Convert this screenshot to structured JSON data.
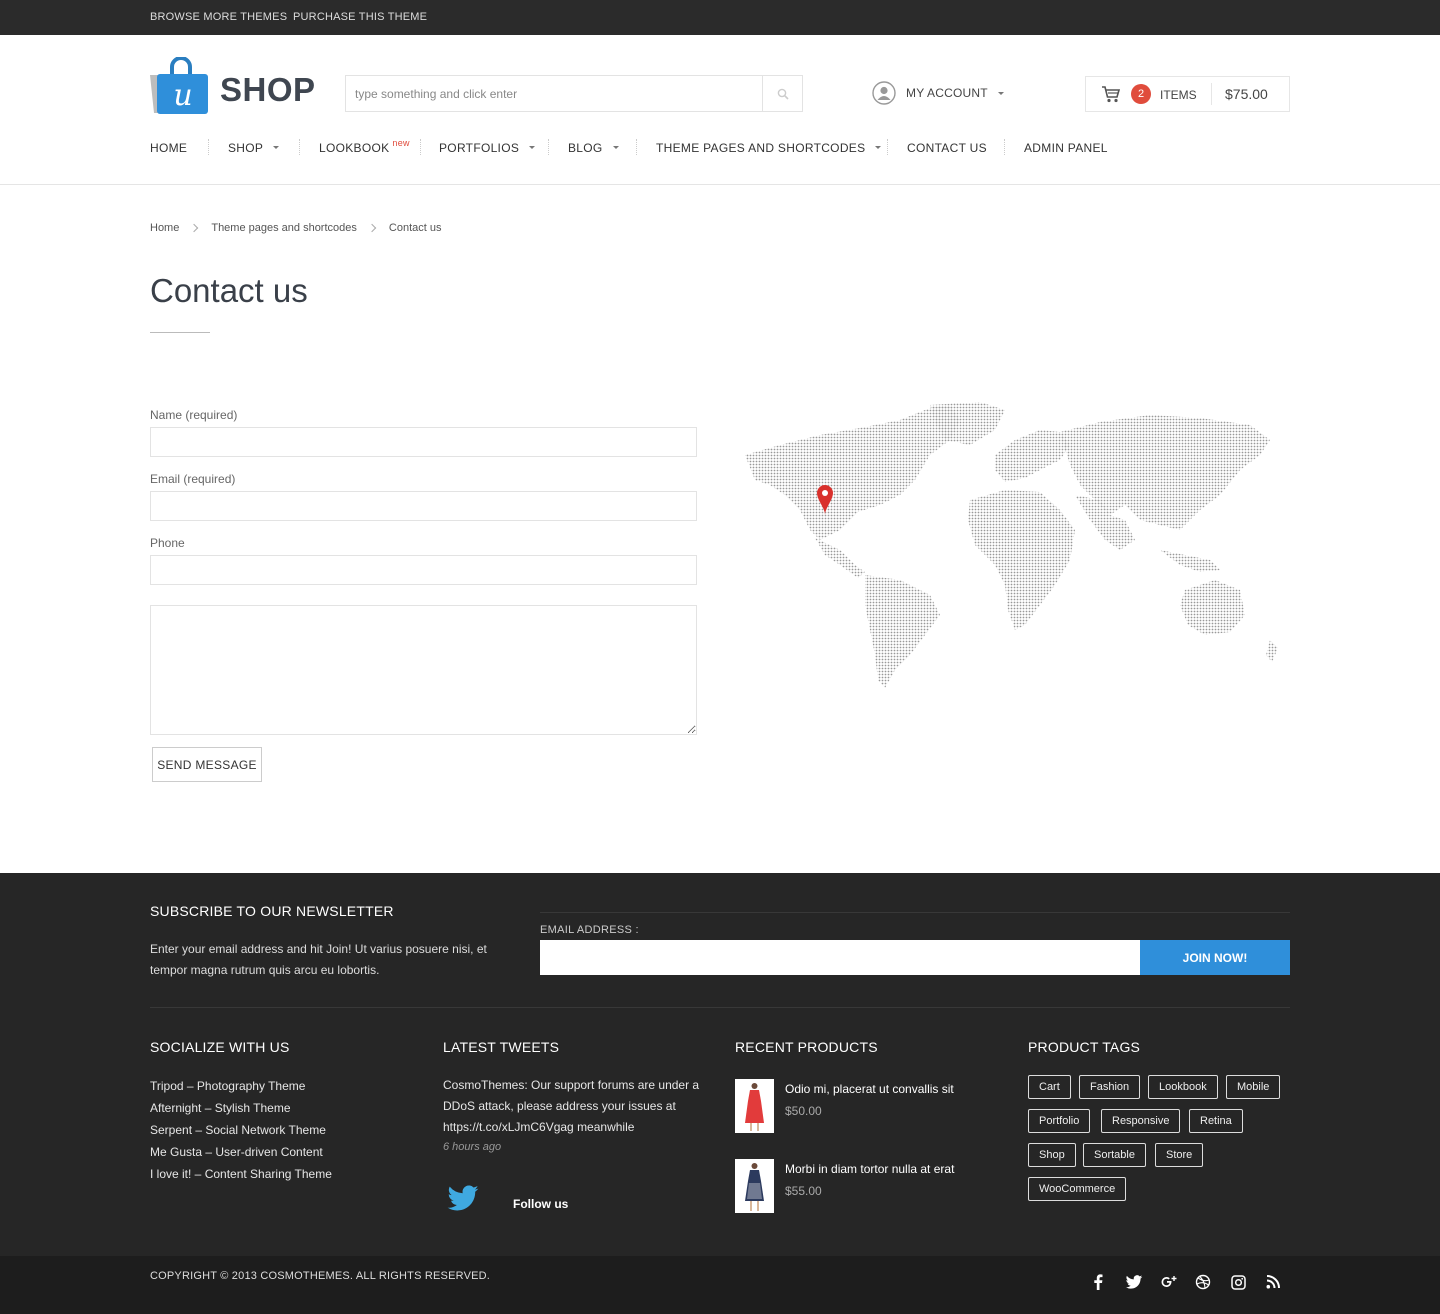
{
  "topbar": {
    "browse": "BROWSE MORE THEMES",
    "purchase": "PURCHASE THIS THEME"
  },
  "logo": {
    "text": "SHOP",
    "mark": "u"
  },
  "search": {
    "placeholder": "type something and click enter"
  },
  "account": {
    "label": "MY ACCOUNT"
  },
  "cart": {
    "count": "2",
    "items_label": "ITEMS",
    "total": "$75.00"
  },
  "nav": {
    "home": "HOME",
    "shop": "SHOP",
    "lookbook": "LOOKBOOK",
    "lookbook_badge": "new",
    "portfolios": "PORTFOLIOS",
    "blog": "BLOG",
    "theme_pages": "THEME PAGES AND SHORTCODES",
    "contact": "CONTACT US",
    "admin": "ADMIN PANEL"
  },
  "breadcrumb": {
    "home": "Home",
    "section": "Theme pages and shortcodes",
    "current": "Contact us"
  },
  "page": {
    "title": "Contact us"
  },
  "form": {
    "name_label": "Name (required)",
    "email_label": "Email (required)",
    "phone_label": "Phone",
    "send_label": "SEND MESSAGE"
  },
  "newsletter": {
    "heading": "SUBSCRIBE TO OUR NEWSLETTER",
    "text_line1": "Enter your email address and hit Join! Ut varius posuere nisi, et",
    "text_line2": "tempor magna rutrum quis arcu eu lobortis.",
    "email_label": "EMAIL ADDRESS :",
    "join_label": "JOIN NOW!"
  },
  "socialize": {
    "heading": "SOCIALIZE WITH US",
    "links": [
      "Tripod – Photography Theme",
      "Afternight – Stylish Theme",
      "Serpent – Social Network Theme",
      "Me Gusta – User-driven Content",
      "I love it! – Content Sharing Theme"
    ]
  },
  "tweets": {
    "heading": "LATEST TWEETS",
    "line1": "CosmoThemes: Our support forums are under a",
    "line2": "DDoS attack, please address your issues at",
    "line3": "https://t.co/xLJmC6Vgag meanwhile",
    "time": "6 hours ago",
    "follow": "Follow us"
  },
  "recent_products": {
    "heading": "RECENT PRODUCTS",
    "items": [
      {
        "name": "Odio mi, placerat ut convallis sit",
        "price": "$50.00",
        "color": "#e23b3b"
      },
      {
        "name": "Morbi in diam tortor nulla at erat",
        "price": "$55.00",
        "color": "#2c3a5e"
      }
    ]
  },
  "product_tags": {
    "heading": "PRODUCT TAGS",
    "tags": [
      "Cart",
      "Fashion",
      "Lookbook",
      "Mobile",
      "Portfolio",
      "Responsive",
      "Retina",
      "Shop",
      "Sortable",
      "Store",
      "WooCommerce"
    ]
  },
  "footer": {
    "copyright": "COPYRIGHT © 2013 COSMOTHEMES. ALL RIGHTS RESERVED."
  },
  "social_icons": [
    "facebook-icon",
    "twitter-icon",
    "google-plus-icon",
    "dribbble-icon",
    "instagram-icon",
    "rss-icon"
  ],
  "colors": {
    "accent": "#2f8fda",
    "badge": "#e04c3c",
    "footer_bg": "#262626",
    "bottom_bg": "#1d1d1d"
  }
}
